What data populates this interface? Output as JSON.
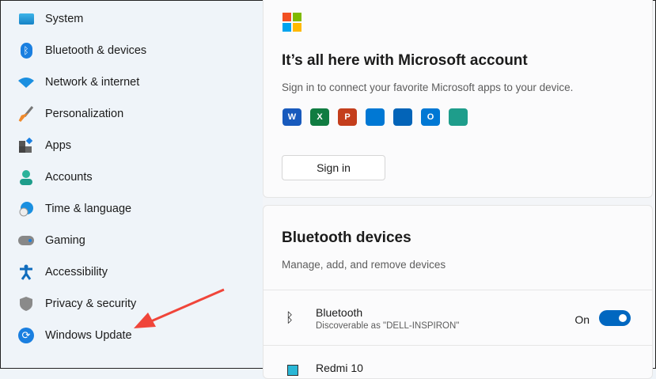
{
  "sidebar": {
    "items": [
      {
        "label": "System",
        "icon": "system-icon"
      },
      {
        "label": "Bluetooth & devices",
        "icon": "bluetooth-icon"
      },
      {
        "label": "Network & internet",
        "icon": "wifi-icon"
      },
      {
        "label": "Personalization",
        "icon": "brush-icon"
      },
      {
        "label": "Apps",
        "icon": "apps-icon"
      },
      {
        "label": "Accounts",
        "icon": "person-icon"
      },
      {
        "label": "Time & language",
        "icon": "globe-clock-icon"
      },
      {
        "label": "Gaming",
        "icon": "gamepad-icon"
      },
      {
        "label": "Accessibility",
        "icon": "accessibility-icon"
      },
      {
        "label": "Privacy & security",
        "icon": "shield-icon"
      },
      {
        "label": "Windows Update",
        "icon": "update-icon"
      }
    ]
  },
  "account_card": {
    "title": "It’s all here with Microsoft account",
    "subtitle": "Sign in to connect your favorite Microsoft apps to your device.",
    "sign_in": "Sign in",
    "apps": [
      {
        "name": "word",
        "letter": "W",
        "color": "#185abd"
      },
      {
        "name": "excel",
        "letter": "X",
        "color": "#107c41"
      },
      {
        "name": "powerpoint",
        "letter": "P",
        "color": "#c43e1c"
      },
      {
        "name": "defender",
        "letter": "",
        "color": "#0078d4"
      },
      {
        "name": "onedrive",
        "letter": "",
        "color": "#0364b8"
      },
      {
        "name": "outlook",
        "letter": "O",
        "color": "#0078d4"
      },
      {
        "name": "family",
        "letter": "",
        "color": "#1e9d8b"
      }
    ]
  },
  "bluetooth_card": {
    "title": "Bluetooth devices",
    "subtitle": "Manage, add, and remove devices",
    "bluetooth_row": {
      "title": "Bluetooth",
      "subtitle": "Discoverable as \"DELL-INSPIRON\"",
      "state": "On"
    },
    "device": {
      "name": "Redmi 10"
    }
  },
  "accent": "#0067c0"
}
